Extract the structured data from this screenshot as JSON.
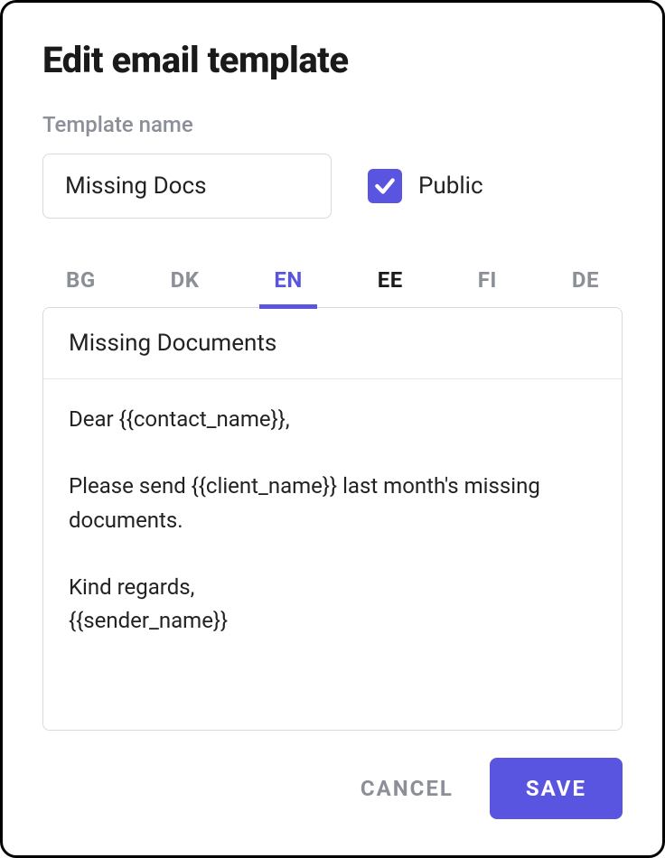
{
  "modal": {
    "title": "Edit email template",
    "template_name_label": "Template name",
    "template_name_value": "Missing Docs",
    "public_checked": true,
    "public_label": "Public"
  },
  "tabs": [
    {
      "code": "BG",
      "state": "muted"
    },
    {
      "code": "DK",
      "state": "muted"
    },
    {
      "code": "EN",
      "state": "active"
    },
    {
      "code": "EE",
      "state": "dark"
    },
    {
      "code": "FI",
      "state": "muted"
    },
    {
      "code": "DE",
      "state": "muted"
    }
  ],
  "editor": {
    "subject": "Missing Documents",
    "body": "Dear {{contact_name}},\n\nPlease send {{client_name}} last month's missing documents.\n\nKind regards,\n{{sender_name}}"
  },
  "actions": {
    "cancel": "CANCEL",
    "save": "SAVE"
  },
  "colors": {
    "accent": "#5a55e0",
    "muted": "#8a8f98",
    "border": "#d7d9dd"
  }
}
